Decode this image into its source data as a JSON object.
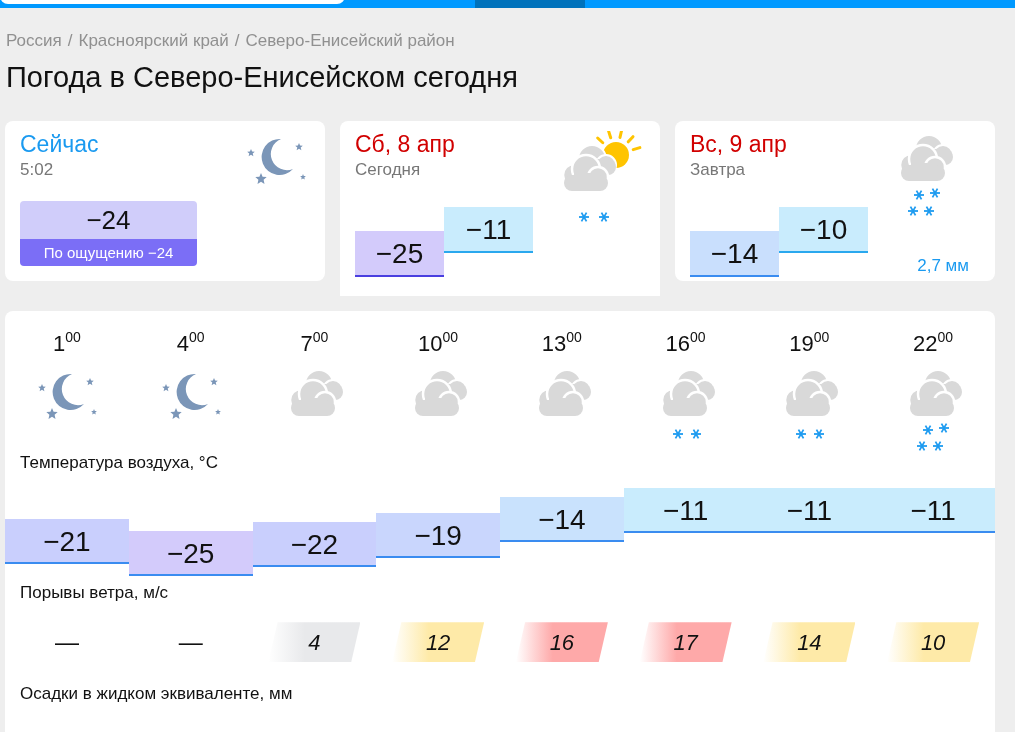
{
  "breadcrumbs": [
    "Россия",
    "Красноярский край",
    "Северо-Енисейский район"
  ],
  "breadcrumb_separator": "/",
  "title": "Погода в Северо-Енисейском сегодня",
  "cards": [
    {
      "kind": "now",
      "selected": false,
      "heading": "Сейчас",
      "subheading": "5:02",
      "temp": "−24",
      "feels": "По ощущению −24"
    },
    {
      "kind": "day",
      "selected": true,
      "heading": "Сб, 8 апр",
      "subheading": "Сегодня",
      "low": "−25",
      "high": "−11"
    },
    {
      "kind": "day",
      "selected": false,
      "heading": "Вс, 9 апр",
      "subheading": "Завтра",
      "low": "−14",
      "high": "−10",
      "precip": "2,7 мм"
    }
  ],
  "hours": [
    {
      "time": "1$^{00}$",
      "kind": "night"
    },
    {
      "time": "4$^{00}$",
      "kind": "night"
    },
    {
      "time": "7$^{00}$",
      "kind": "cloudy"
    },
    {
      "time": "10$^{00}$",
      "kind": "cloudy"
    },
    {
      "time": "13$^{00}$",
      "kind": "cloudy"
    },
    {
      "time": "16$^{00}$",
      "kind": "light-snow"
    },
    {
      "time": "19$^{00}$",
      "kind": "light-snow"
    },
    {
      "time": "22$^{00}$",
      "kind": "snow"
    }
  ],
  "temperature_label": "Температура воздуха, °C",
  "temperatures": [
    {
      "value": "−21",
      "color": "#c9cffd"
    },
    {
      "value": "−25",
      "color": "#d3cbfb"
    },
    {
      "value": "−22",
      "color": "#c9cffd"
    },
    {
      "value": "−19",
      "color": "#c9d6fd"
    },
    {
      "value": "−14",
      "color": "#c9e2fd"
    },
    {
      "value": "−11",
      "color": "#c9ecfd"
    },
    {
      "value": "−11",
      "color": "#c9ecfd"
    },
    {
      "value": "−11",
      "color": "#c9ecfd"
    }
  ],
  "wind_label": "Порывы ветра, м/с",
  "wind_gusts": [
    {
      "kind": "none",
      "value": "—"
    },
    {
      "kind": "none",
      "value": "—"
    },
    {
      "kind": "gust",
      "value": "4",
      "color": "#e8e9eb"
    },
    {
      "kind": "gust",
      "value": "12",
      "color": "#feeaa8"
    },
    {
      "kind": "gust",
      "value": "16",
      "color": "#fea9a9"
    },
    {
      "kind": "gust",
      "value": "17",
      "color": "#fea9a9"
    },
    {
      "kind": "gust",
      "value": "14",
      "color": "#feeaa8"
    },
    {
      "kind": "gust",
      "value": "10",
      "color": "#feeaa8"
    }
  ],
  "precip_label": "Осадки в жидком эквиваленте, мм"
}
